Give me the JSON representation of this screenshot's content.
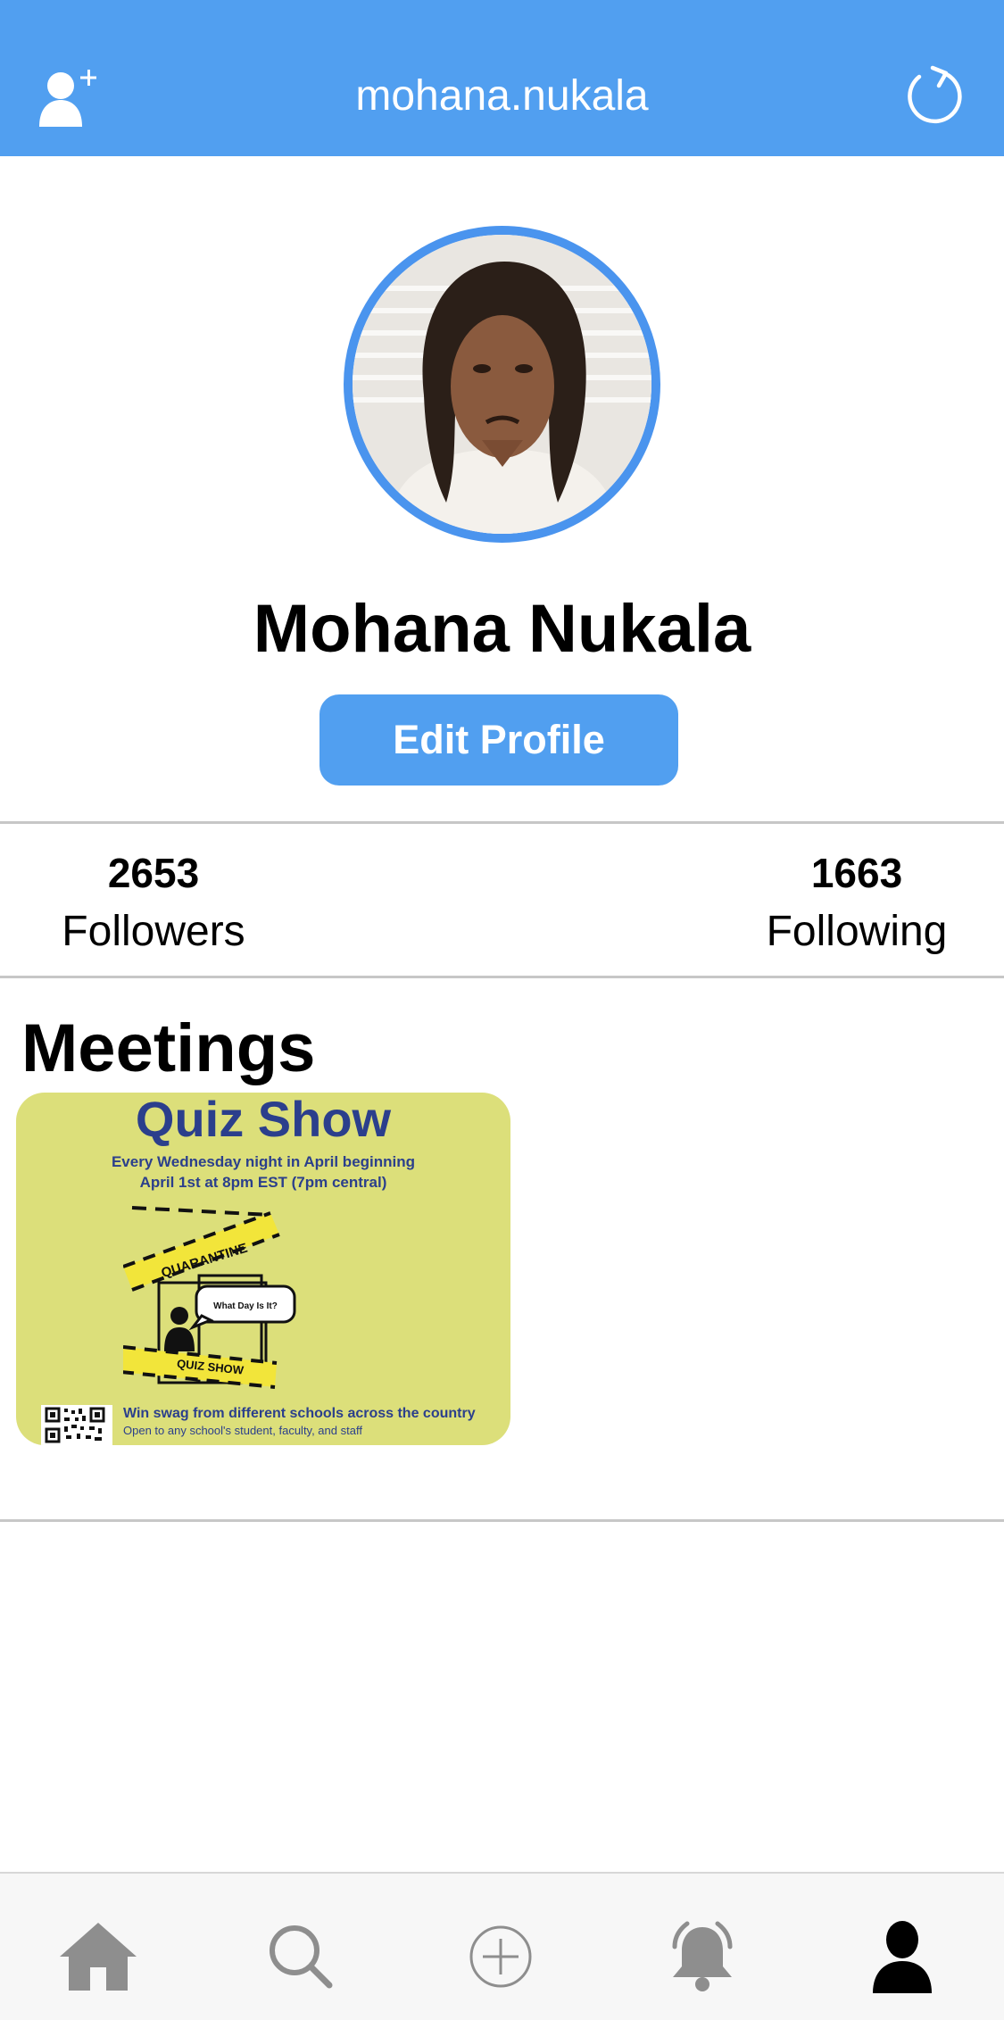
{
  "header": {
    "username": "mohana.nukala",
    "add_user_icon": "add-user-icon",
    "refresh_icon": "refresh-icon",
    "color": "#519ff0"
  },
  "profile": {
    "name": "Mohana Nukala",
    "edit_button_label": "Edit Profile",
    "avatar": "profile-photo"
  },
  "stats": {
    "followers_count": "2653",
    "followers_label": "Followers",
    "following_count": "1663",
    "following_label": "Following"
  },
  "meetings": {
    "section_title": "Meetings",
    "items": [
      {
        "poster_title": "Quiz Show",
        "poster_line1": "Every Wednesday night in April beginning",
        "poster_line2": "April 1st at 8pm EST (7pm central)",
        "tape_top": "QUARANTINE",
        "speech_bubble": "What Day Is It?",
        "tape_bottom": "QUIZ SHOW",
        "swag_line": "Win swag from different schools across the country",
        "open_line": "Open to any school's student, faculty, and staff"
      }
    ]
  },
  "tabbar": {
    "items": [
      {
        "icon": "home-icon",
        "active": false
      },
      {
        "icon": "search-icon",
        "active": false
      },
      {
        "icon": "add-circle-icon",
        "active": false
      },
      {
        "icon": "bell-icon",
        "active": false
      },
      {
        "icon": "profile-icon",
        "active": true
      }
    ]
  }
}
